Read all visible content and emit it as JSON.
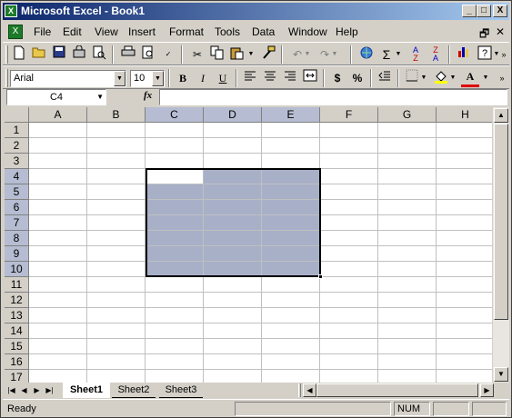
{
  "title": "Microsoft Excel - Book1",
  "caption_buttons": {
    "minimize": "_",
    "restore": "□",
    "close": "X"
  },
  "menu": [
    "File",
    "Edit",
    "View",
    "Insert",
    "Format",
    "Tools",
    "Data",
    "Window",
    "Help"
  ],
  "mdi_controls": {
    "restore": "🗗",
    "close": "✕"
  },
  "formatting": {
    "font": "Arial",
    "size": "10",
    "bold": "B",
    "italic": "I",
    "underline": "U",
    "currency": "$",
    "percent": "%"
  },
  "name_box": "C4",
  "fx_label": "fx",
  "columns": [
    "A",
    "B",
    "C",
    "D",
    "E",
    "F",
    "G",
    "H"
  ],
  "rows": [
    "1",
    "2",
    "3",
    "4",
    "5",
    "6",
    "7",
    "8",
    "9",
    "10",
    "11",
    "12",
    "13",
    "14",
    "15",
    "16",
    "17"
  ],
  "selection": {
    "range": "C4:E10",
    "active_cell": "C4"
  },
  "sheets": [
    "Sheet1",
    "Sheet2",
    "Sheet3"
  ],
  "active_sheet": "Sheet1",
  "status": {
    "text": "Ready",
    "num": "NUM"
  },
  "colors": {
    "title_start": "#0a246a",
    "title_end": "#a6caf0",
    "selection_fill": "#a8b0c8",
    "face": "#d4d0c8"
  }
}
